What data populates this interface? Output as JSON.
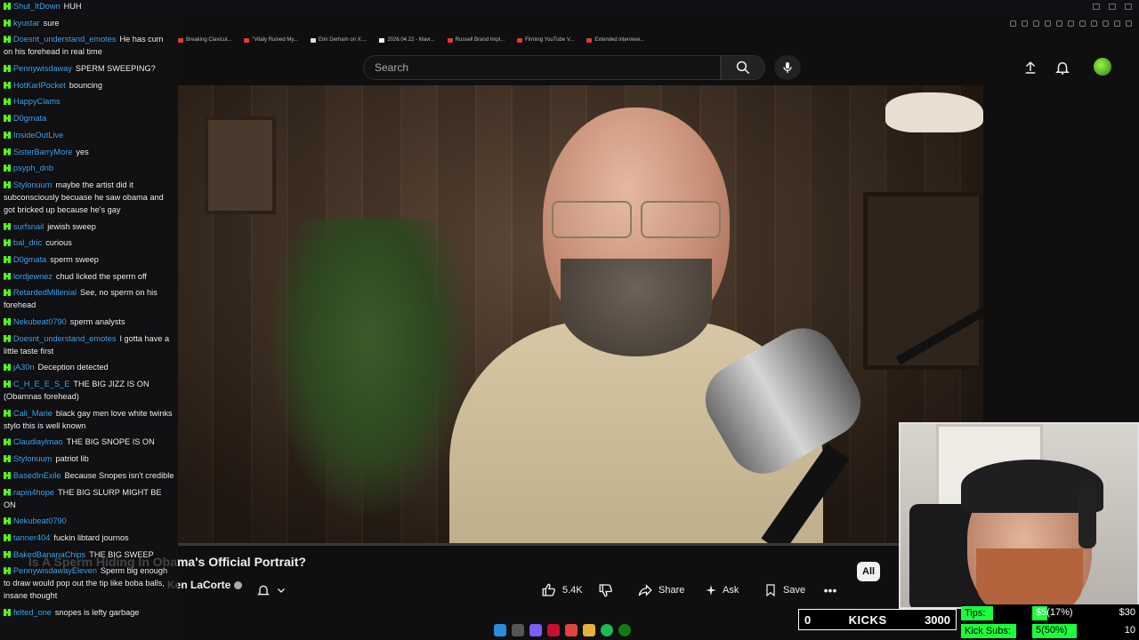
{
  "browser": {
    "bookmarks": [
      "Breaking Clavicul...",
      "\"Vitaly Ruined My...",
      "Erin Derham on X:...",
      "2026.04.22 - Mavr...",
      "Russell Brand Impl...",
      "Firming YouTube V...",
      "Extended interview..."
    ]
  },
  "header": {
    "search_placeholder": "Search"
  },
  "video": {
    "title": "Is A Sperm Hiding In Obama's Official Portrait?",
    "channel": "Ken LaCorte",
    "progress": 0.0
  },
  "actions": {
    "likes": "5.4K",
    "share": "Share",
    "ask": "Ask",
    "save": "Save"
  },
  "chips": {
    "all": "All"
  },
  "chat": [
    {
      "user": "Shut_ItDown",
      "text": "HUH"
    },
    {
      "user": "kyustar",
      "text": "sure"
    },
    {
      "user": "Doesnt_understand_emotes",
      "text": "He has cum on his forehead in real time"
    },
    {
      "user": "Pennywisdaway",
      "text": "SPERM SWEEPING?"
    },
    {
      "user": "HotKarlPocket",
      "text": "bouncing"
    },
    {
      "user": "HappyClams",
      "text": ""
    },
    {
      "user": "D0gmata",
      "text": ""
    },
    {
      "user": "InsideOutLive",
      "text": ""
    },
    {
      "user": "SisterBarryMore",
      "text": "yes"
    },
    {
      "user": "psyph_dnb",
      "text": ""
    },
    {
      "user": "Stylonuum",
      "text": "maybe the artist did it subconsciously becuase he saw obama and got bricked up because he's gay"
    },
    {
      "user": "surfsnail",
      "text": "jewish sweep"
    },
    {
      "user": "bal_dric",
      "text": "curious"
    },
    {
      "user": "D0gmata",
      "text": "sperm sweep"
    },
    {
      "user": "lordjewnez",
      "text": "chud licked the sperm off"
    },
    {
      "user": "RetardedMillenial",
      "text": "See, no sperm on his forehead"
    },
    {
      "user": "Nekubeat0790",
      "text": "sperm analysts"
    },
    {
      "user": "Doesnt_understand_emotes",
      "text": "I gotta have a little taste first"
    },
    {
      "user": "jA30n",
      "text": "Deception detected"
    },
    {
      "user": "C_H_E_E_S_E",
      "text": "THE BIG JIZZ IS ON (Obamnas forehead)"
    },
    {
      "user": "Cali_Marie",
      "text": "black gay men love white twinks stylo this is well known"
    },
    {
      "user": "Claudiaylmao",
      "text": "THE BIG SNOPE IS ON"
    },
    {
      "user": "Stylonuum",
      "text": "patriot lib"
    },
    {
      "user": "BasedInExile",
      "text": "Because Snopes isn't credible"
    },
    {
      "user": "rapin4hope",
      "text": "THE BIG SLURP MIGHT BE ON"
    },
    {
      "user": "Nekubeat0790",
      "text": ""
    },
    {
      "user": "tanner404",
      "text": "fuckin libtard journos"
    },
    {
      "user": "BakedBananaChips",
      "text": "THE BIG SWEEP"
    },
    {
      "user": "PennywisdawayEleven",
      "text": "Sperm big enough to draw would pop out the tip like boba balls, insane thought"
    },
    {
      "user": "felted_one",
      "text": "snopes is lefty garbage"
    }
  ],
  "kicks": {
    "count": "0",
    "label": "KICKS",
    "goal": "3000"
  },
  "stats": {
    "tips_label": "Tips:",
    "tips_value": "$5(17%)",
    "tips_goal": "$30",
    "tips_fraction": 0.17,
    "subs_label": "Kick Subs:",
    "subs_value": "5(50%)",
    "subs_goal": "10",
    "subs_fraction": 0.5
  },
  "icons": {
    "search": "search-icon",
    "mic": "mic-icon",
    "upload": "upload-icon",
    "bell": "bell-icon",
    "like": "thumbs-up-icon",
    "dislike": "thumbs-down-icon",
    "share": "share-icon",
    "ask": "sparkle-icon",
    "save": "bookmark-icon",
    "more": "more-icon"
  },
  "colors": {
    "kick_green": "#53fc18",
    "stat_green": "#1aff3a",
    "youtube_red": "#ff0000"
  }
}
